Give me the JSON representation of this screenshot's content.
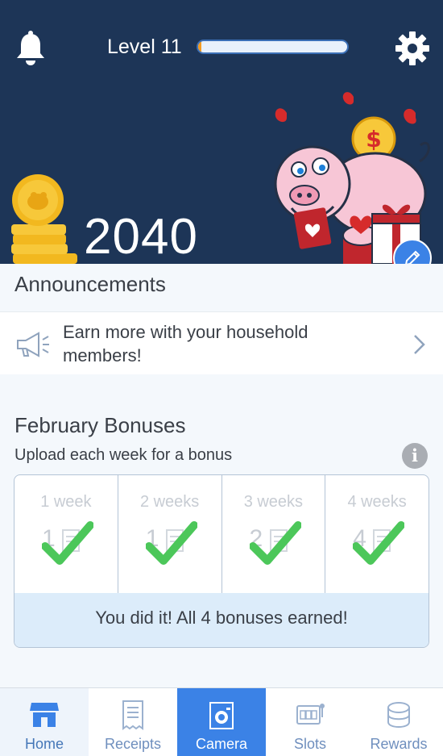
{
  "header": {
    "level_label": "Level 11",
    "level_progress_pct": 2,
    "points": "2040",
    "colors": {
      "background": "#1d3557",
      "progress_fill": "#f49b20"
    }
  },
  "announcements": {
    "title": "Announcements",
    "items": [
      {
        "text": "Earn more with your household members!",
        "icon": "megaphone-icon"
      }
    ]
  },
  "bonuses": {
    "title": "February Bonuses",
    "subtitle": "Upload each week for a bonus",
    "info_glyph": "i",
    "weeks": [
      {
        "label": "1 week",
        "count": "1",
        "completed": true
      },
      {
        "label": "2 weeks",
        "count": "1",
        "completed": true
      },
      {
        "label": "3 weeks",
        "count": "2",
        "completed": true
      },
      {
        "label": "4 weeks",
        "count": "4",
        "completed": true
      }
    ],
    "banner": "You did it! All 4 bonuses earned!"
  },
  "nav": {
    "items": [
      {
        "label": "Home",
        "icon": "home-icon"
      },
      {
        "label": "Receipts",
        "icon": "receipt-icon"
      },
      {
        "label": "Camera",
        "icon": "camera-icon"
      },
      {
        "label": "Slots",
        "icon": "slots-icon"
      },
      {
        "label": "Rewards",
        "icon": "coins-icon"
      }
    ],
    "active": "Camera",
    "active_color": "#3b82e6"
  }
}
